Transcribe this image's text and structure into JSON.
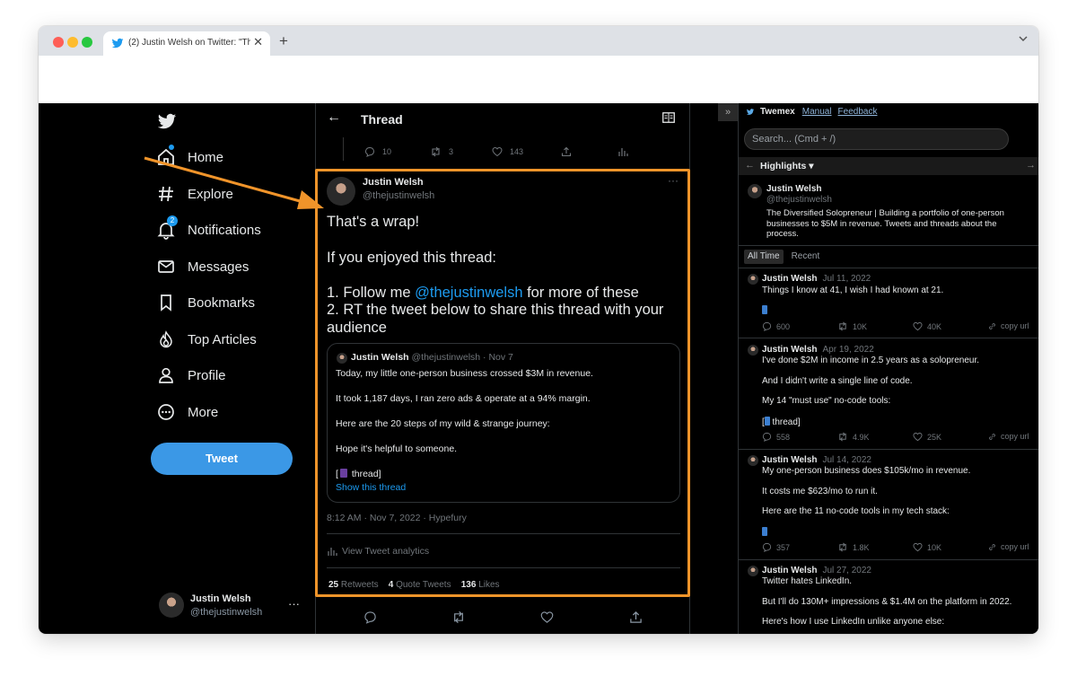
{
  "browser": {
    "tab_title": "(2) Justin Welsh on Twitter: \"Th",
    "close_glyph": "✕",
    "new_tab_glyph": "+",
    "menu_glyph": "⌄"
  },
  "nav": {
    "items": [
      {
        "label": "Home",
        "icon": "home-icon"
      },
      {
        "label": "Explore",
        "icon": "hashtag-icon"
      },
      {
        "label": "Notifications",
        "icon": "bell-icon",
        "badge": "2"
      },
      {
        "label": "Messages",
        "icon": "envelope-icon"
      },
      {
        "label": "Bookmarks",
        "icon": "bookmark-icon"
      },
      {
        "label": "Top Articles",
        "icon": "flame-icon"
      },
      {
        "label": "Profile",
        "icon": "person-icon"
      },
      {
        "label": "More",
        "icon": "more-circle-icon"
      }
    ],
    "tweet_button": "Tweet",
    "account": {
      "name": "Justin Welsh",
      "handle": "@thejustinwelsh",
      "more": "···"
    }
  },
  "thread": {
    "title": "Thread",
    "back_glyph": "←",
    "prev_actions": {
      "replies": "10",
      "retweets": "3",
      "likes": "143"
    },
    "tweet": {
      "name": "Justin Welsh",
      "handle": "@thejustinwelsh",
      "more": "···",
      "line1": "That's a wrap!",
      "line2": "If you enjoyed this thread:",
      "line3_pre": "1. Follow me ",
      "line3_mention": "@thejustinwelsh",
      "line3_post": " for more of these",
      "line4": "2. RT the tweet below to share this thread with your",
      "line5": "audience",
      "quote": {
        "name": "Justin Welsh",
        "handle_date": "@thejustinwelsh · Nov 7",
        "line1": "Today, my little one-person business crossed $3M in revenue.",
        "line2": "It took 1,187 days, I ran zero ads & operate at a 94% margin.",
        "line3": "Here are the 20 steps of my wild & strange journey:",
        "line4": "Hope it's helpful to someone.",
        "line5_pre": "[",
        "line5_post": " thread]",
        "show_thread": "Show this thread"
      },
      "meta": "8:12 AM · Nov 7, 2022 · Hypefury",
      "analytics": "View Tweet analytics",
      "retweets_count": "25",
      "retweets_label": "Retweets",
      "quotes_count": "4",
      "quotes_label": "Quote Tweets",
      "likes_count": "136",
      "likes_label": "Likes"
    }
  },
  "twemex": {
    "collapse_glyph": "»",
    "brand": "Twemex",
    "manual": "Manual",
    "feedback": "Feedback",
    "search_placeholder": "Search... (Cmd + /)",
    "highlights": "Highlights ▾",
    "left_arrow": "←",
    "right_arrow": "→",
    "profile": {
      "name": "Justin Welsh",
      "handle": "@thejustinwelsh",
      "bio": "The Diversified Solopreneur | Building a portfolio of one-person businesses to $5M in revenue. Tweets and threads about the process."
    },
    "tabs": [
      "All Time",
      "Recent"
    ],
    "tweets": [
      {
        "name": "Justin Welsh",
        "date": "Jul 11, 2022",
        "lines": [
          "Things I know at 41, I wish I had known at 21."
        ],
        "replies": "600",
        "retweets": "10K",
        "likes": "40K",
        "copy": "copy url"
      },
      {
        "name": "Justin Welsh",
        "date": "Apr 19, 2022",
        "lines": [
          "I've done $2M in income in 2.5 years as a solopreneur.",
          "And I didn't write a single line of code.",
          "My 14 \"must use\" no-code tools:",
          "[",
          " thread]"
        ],
        "replies": "558",
        "retweets": "4.9K",
        "likes": "25K",
        "copy": "copy url"
      },
      {
        "name": "Justin Welsh",
        "date": "Jul 14, 2022",
        "lines": [
          "My one-person business does $105k/mo in revenue.",
          "It costs me $623/mo to run it.",
          "Here are the 11 no-code tools in my tech stack:"
        ],
        "replies": "357",
        "retweets": "1.8K",
        "likes": "10K",
        "copy": "copy url"
      },
      {
        "name": "Justin Welsh",
        "date": "Jul 27, 2022",
        "lines": [
          "Twitter hates LinkedIn.",
          "But I'll do 130M+ impressions & $1.4M on the platform in 2022.",
          "Here's how I use LinkedIn unlike anyone else:"
        ]
      }
    ]
  },
  "colors": {
    "accent": "#1d9bf0",
    "highlight": "#f0942a",
    "tweet_button": "#3b98e6"
  }
}
